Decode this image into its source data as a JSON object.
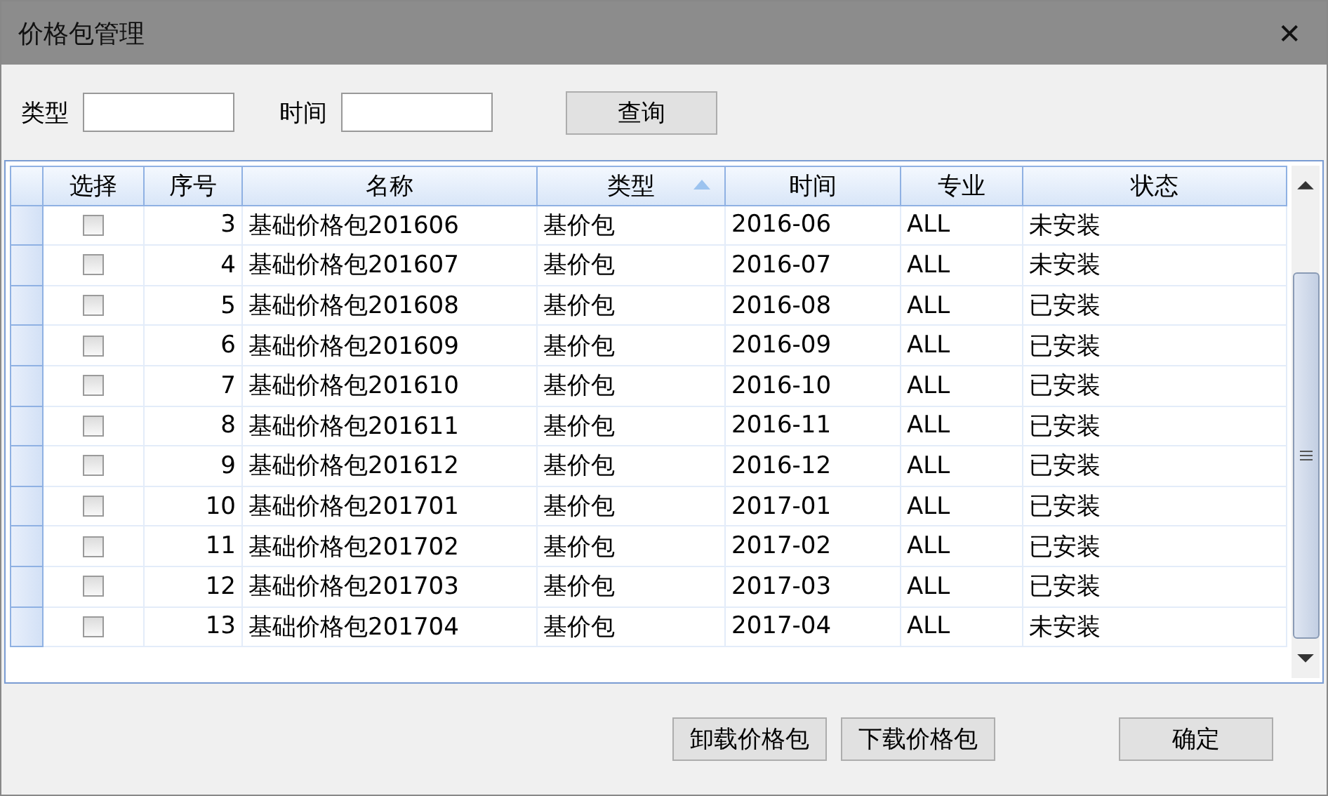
{
  "window": {
    "title": "价格包管理",
    "close": "✕"
  },
  "filters": [
    {
      "label": "类型"
    },
    {
      "label": "时间"
    }
  ],
  "query_button": "查询",
  "table": {
    "columns": [
      {
        "label": "选择",
        "sorted": false
      },
      {
        "label": "序号",
        "sorted": false
      },
      {
        "label": "名称",
        "sorted": false
      },
      {
        "label": "类型",
        "sorted": true
      },
      {
        "label": "时间",
        "sorted": false
      },
      {
        "label": "专业",
        "sorted": false
      },
      {
        "label": "状态",
        "sorted": false
      }
    ],
    "rows": [
      {
        "checked": false,
        "no": "3",
        "name": "基础价格包201606",
        "type": "基价包",
        "time": "2016-06",
        "major": "ALL",
        "status": "未安装"
      },
      {
        "checked": false,
        "no": "4",
        "name": "基础价格包201607",
        "type": "基价包",
        "time": "2016-07",
        "major": "ALL",
        "status": "未安装"
      },
      {
        "checked": false,
        "no": "5",
        "name": "基础价格包201608",
        "type": "基价包",
        "time": "2016-08",
        "major": "ALL",
        "status": "已安装"
      },
      {
        "checked": false,
        "no": "6",
        "name": "基础价格包201609",
        "type": "基价包",
        "time": "2016-09",
        "major": "ALL",
        "status": "已安装"
      },
      {
        "checked": false,
        "no": "7",
        "name": "基础价格包201610",
        "type": "基价包",
        "time": "2016-10",
        "major": "ALL",
        "status": "已安装"
      },
      {
        "checked": false,
        "no": "8",
        "name": "基础价格包201611",
        "type": "基价包",
        "time": "2016-11",
        "major": "ALL",
        "status": "已安装"
      },
      {
        "checked": false,
        "no": "9",
        "name": "基础价格包201612",
        "type": "基价包",
        "time": "2016-12",
        "major": "ALL",
        "status": "已安装"
      },
      {
        "checked": false,
        "no": "10",
        "name": "基础价格包201701",
        "type": "基价包",
        "time": "2017-01",
        "major": "ALL",
        "status": "已安装"
      },
      {
        "checked": false,
        "no": "11",
        "name": "基础价格包201702",
        "type": "基价包",
        "time": "2017-02",
        "major": "ALL",
        "status": "已安装"
      },
      {
        "checked": false,
        "no": "12",
        "name": "基础价格包201703",
        "type": "基价包",
        "time": "2017-03",
        "major": "ALL",
        "status": "已安装"
      },
      {
        "checked": false,
        "no": "13",
        "name": "基础价格包201704",
        "type": "基价包",
        "time": "2017-04",
        "major": "ALL",
        "status": "未安装"
      }
    ]
  },
  "buttons": [
    "卸载价格包",
    "下载价格包",
    "确定"
  ]
}
